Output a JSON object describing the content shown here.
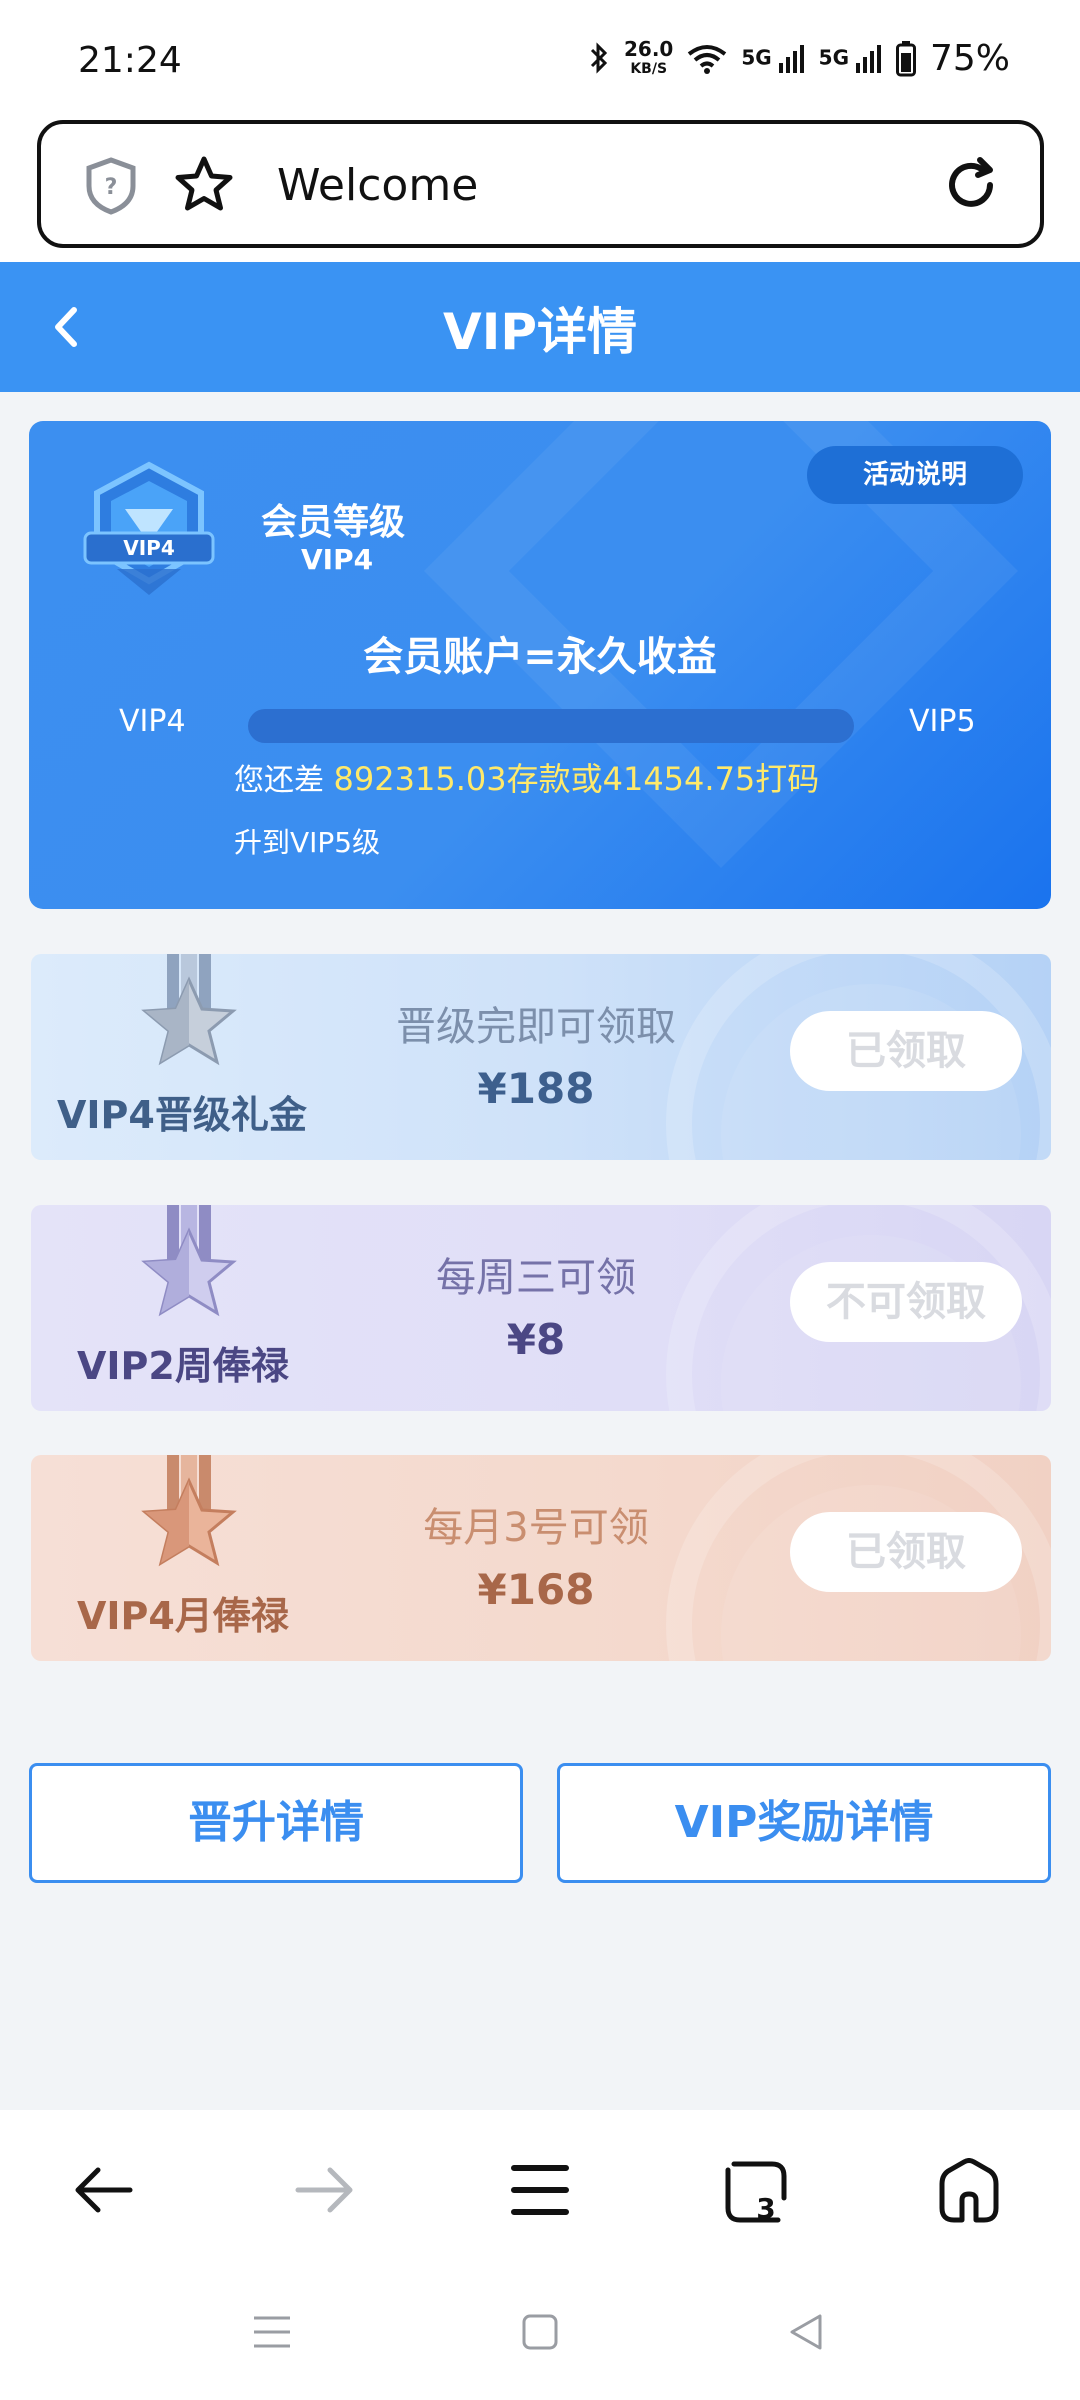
{
  "status_bar": {
    "time": "21:24",
    "net_speed_value": "26.0",
    "net_speed_unit": "KB/S",
    "signal_1": "5G",
    "signal_2": "5G",
    "battery": "75%"
  },
  "browser": {
    "url_text": "Welcome"
  },
  "header": {
    "title": "VIP详情"
  },
  "vip_card": {
    "level_label": "会员等级",
    "level_value": "VIP4",
    "badge_text": "VIP4",
    "activity_button": "活动说明",
    "slogan": "会员账户=永久收益",
    "progress_from": "VIP4",
    "progress_to": "VIP5",
    "progress_fraction": 0.0,
    "remain_prefix": "您还差",
    "remain_highlight": "892315.03存款或41454.75打码",
    "remain_suffix": "升到VIP5级"
  },
  "rewards": [
    {
      "name": "VIP4晋级礼金",
      "condition": "晋级完即可领取",
      "amount": "¥188",
      "button": "已领取",
      "accent": "#3f5f88"
    },
    {
      "name": "VIP2周俸禄",
      "condition": "每周三可领",
      "amount": "¥8",
      "button": "不可领取",
      "accent": "#4b4784"
    },
    {
      "name": "VIP4月俸禄",
      "condition": "每月3号可领",
      "amount": "¥168",
      "button": "已领取",
      "accent": "#a86749"
    }
  ],
  "bottom_buttons": {
    "promotion_details": "晋升详情",
    "vip_reward_details": "VIP奖励详情"
  },
  "browser_nav": {
    "tab_count": "3"
  },
  "colors": {
    "primary": "#3a93f3",
    "highlight": "#ffe96a"
  }
}
